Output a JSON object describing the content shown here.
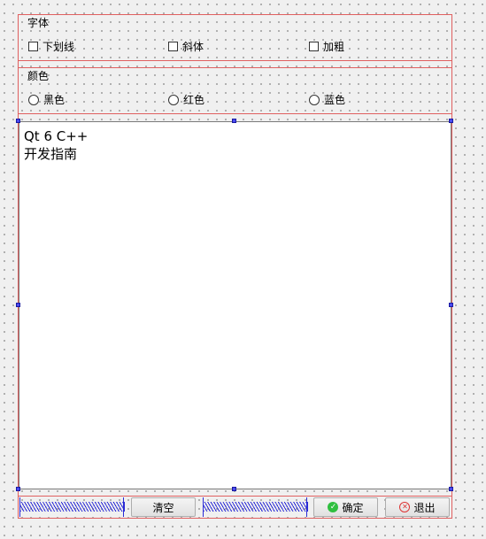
{
  "font_group": {
    "title": "字体",
    "options": [
      "下划线",
      "斜体",
      "加粗"
    ]
  },
  "color_group": {
    "title": "颜色",
    "options": [
      "黑色",
      "红色",
      "蓝色"
    ]
  },
  "editor": {
    "line1": "Qt 6 C++",
    "line2": "开发指南"
  },
  "buttons": {
    "clear": "清空",
    "ok": "确定",
    "exit": "退出"
  },
  "icons": {
    "ok": "check-circle-icon",
    "exit": "close-circle-icon"
  }
}
